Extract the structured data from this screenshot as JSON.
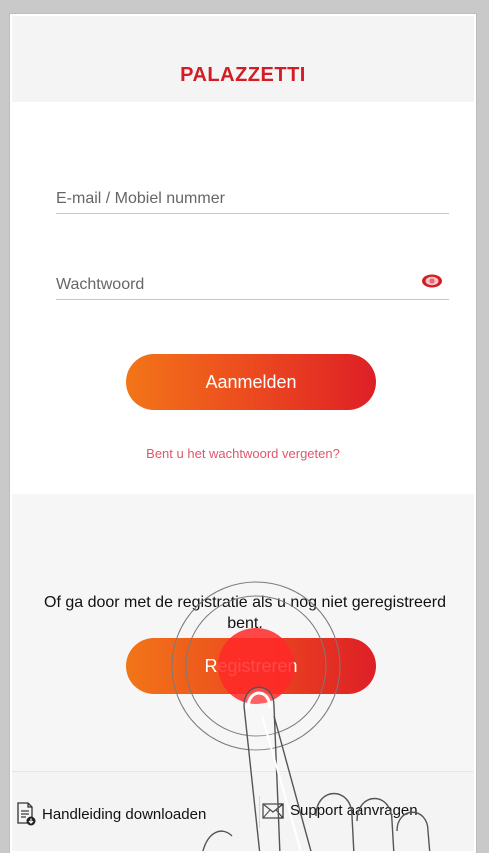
{
  "app": {
    "logo_text": "PALAZZETTI",
    "brand_color": "#d31c24",
    "accent_gradient": [
      "#f27518",
      "#de1f26"
    ]
  },
  "login": {
    "email_placeholder": "E-mail / Mobiel nummer",
    "password_placeholder": "Wachtwoord",
    "show_password_icon": "eye-icon",
    "login_label": "Aanmelden",
    "forgot_label": "Bent u het wachtwoord vergeten?"
  },
  "register": {
    "prompt": "Of ga door met de registratie als u nog niet geregistreerd bent.",
    "register_label": "Registreren"
  },
  "footer": {
    "manual_label": "Handleiding downloaden",
    "manual_icon": "document-download-icon",
    "support_label": "Support aanvragen",
    "support_icon": "envelope-icon"
  }
}
